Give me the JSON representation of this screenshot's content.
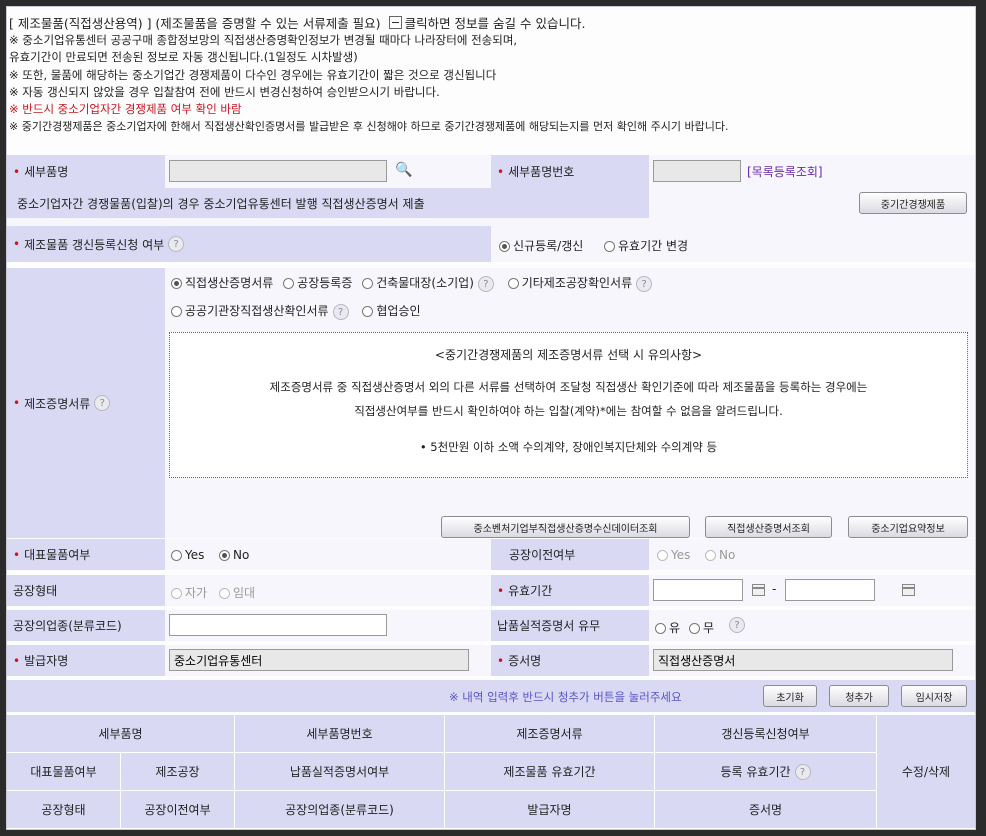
{
  "notice": {
    "title": "[ 제조물품(직접생산용역) ] (제조물품을 증명할 수 있는 서류제출 필요)",
    "toggle_text": "클릭하면 정보를 숨길 수 있습니다.",
    "lines": [
      "※ 중소기업유통센터 공공구매 종합정보망의 직접생산증명확인정보가 변경될 때마다 나라장터에 전송되며,",
      "유효기간이 만료되면 전송된 정보로 자동 갱신됩니다.(1일정도 시차발생)",
      "※ 또한, 물품에 해당하는 중소기업간 경쟁제품이 다수인 경우에는 유효기간이 짧은 것으로 갱신됩니다",
      "※ 자동 갱신되지 않았을 경우 입찰참여 전에 반드시 변경신청하여 승인받으시기 바랍니다."
    ],
    "red_line": "※ 반드시 중소기업자간 경쟁제품 여부 확인 바람",
    "last_line": "※ 중기간경쟁제품은 중소기업자에 한해서 직접생산확인증명서를 발급받은 후 신청해야 하므로 중기간경쟁제품에 해당되는지를 먼저 확인해 주시기 바랍니다."
  },
  "form": {
    "detail_name_label": "세부품명",
    "detail_no_label": "세부품명번호",
    "detail_no_link": "[목록등록조회]",
    "sme_notice": "중소기업자간 경쟁물품(입찰)의 경우 중소기업유통센터 발행 직접생산증명서 제출",
    "sme_button": "중기간경쟁제품",
    "renew_label": "제조물품 갱신등록신청 여부",
    "renew_options": [
      "신규등록/갱신",
      "유효기간 변경"
    ],
    "proof_label": "제조증명서류",
    "proof_options_row1": [
      "직접생산증명서류",
      "공장등록증",
      "건축물대장(소기업)",
      "기타제조공장확인서류"
    ],
    "proof_options_row2": [
      "공공기관장직접생산확인서류",
      "협업승인"
    ],
    "note_title": "<중기간경쟁제품의 제조증명서류 선택 시 유의사항>",
    "note_line1": "제조증명서류 중 직접생산증명서 외의 다른 서류를 선택하여 조달청 직접생산 확인기준에 따라 제조물품을 등록하는 경우에는",
    "note_line2": "직접생산여부를 반드시 확인하여야 하는 입찰(계약)*에는 참여할 수 없음을 알려드립니다.",
    "note_line3": "• 5천만원 이하 소액 수의계약, 장애인복지단체와 수의계약 등",
    "proof_buttons": [
      "중소벤처기업부직접생산증명수신데이터조회",
      "직접생산증명서조회",
      "중소기업요약정보"
    ],
    "rep_label": "대표물품여부",
    "rep_yes": "Yes",
    "rep_no": "No",
    "move_label": "공장이전여부",
    "move_yes": "Yes",
    "move_no": "No",
    "factory_type_label": "공장형태",
    "factory_own": "자가",
    "factory_rent": "임대",
    "valid_label": "유효기간",
    "valid_sep": "-",
    "industry_label": "공장의업종(분류코드)",
    "delivery_label": "납품실적증명서 유무",
    "delivery_yes": "유",
    "delivery_no": "무",
    "issuer_label": "발급자명",
    "issuer_value": "중소기업유통센터",
    "cert_label": "증서명",
    "cert_value": "직접생산증명서",
    "action_note": "※ 내역 입력후 반드시 청추가 버튼을 눌러주세요",
    "action_buttons": [
      "초기화",
      "청추가",
      "임시저장"
    ]
  },
  "table": {
    "row1": [
      "세부품명",
      "세부품명번호",
      "제조증명서류",
      "갱신등록신청여부"
    ],
    "row2": [
      "대표물품여부",
      "제조공장",
      "납품실적증명서여부",
      "제조물품 유효기간",
      "등록 유효기간"
    ],
    "row3": [
      "공장형태",
      "공장이전여부",
      "공장의업종(분류코드)",
      "발급자명",
      "증서명"
    ],
    "edit_col": "수정/삭제"
  },
  "colors": {
    "label_bg": "#d9d9f3",
    "required": "#c8141e",
    "link": "#6a2aa8",
    "note_blue": "#5a55c8"
  }
}
